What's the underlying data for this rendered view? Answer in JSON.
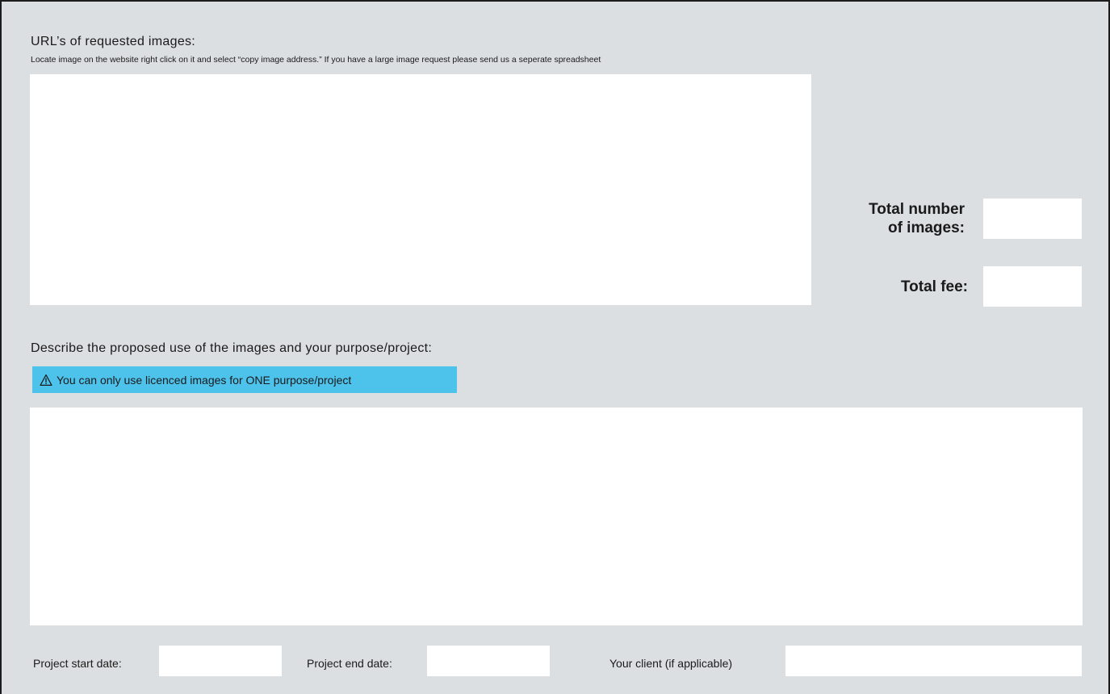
{
  "urls_section": {
    "heading": "URL’s of requested images:",
    "hint": "Locate image on the website right click on it and select “copy image address.” If you have a large image request please send us a seperate spreadsheet",
    "value": ""
  },
  "totals": {
    "images_label_line1": "Total number",
    "images_label_line2": "of images:",
    "images_value": "",
    "fee_label": "Total fee:",
    "fee_value": ""
  },
  "purpose_section": {
    "heading": "Describe the proposed use of the images and your purpose/project:",
    "warning_icon": "warning-triangle-icon",
    "warning_text": "You can only use licenced images for ONE purpose/project",
    "value": ""
  },
  "project": {
    "start_label": "Project start date:",
    "start_value": "",
    "end_label": "Project end date:",
    "end_value": "",
    "client_label": "Your client (if applicable)",
    "client_value": ""
  },
  "colors": {
    "page_background": "#dcdfe2",
    "field_background": "#ffffff",
    "banner_background": "#4dc3ec",
    "border": "#1c1c1c"
  }
}
